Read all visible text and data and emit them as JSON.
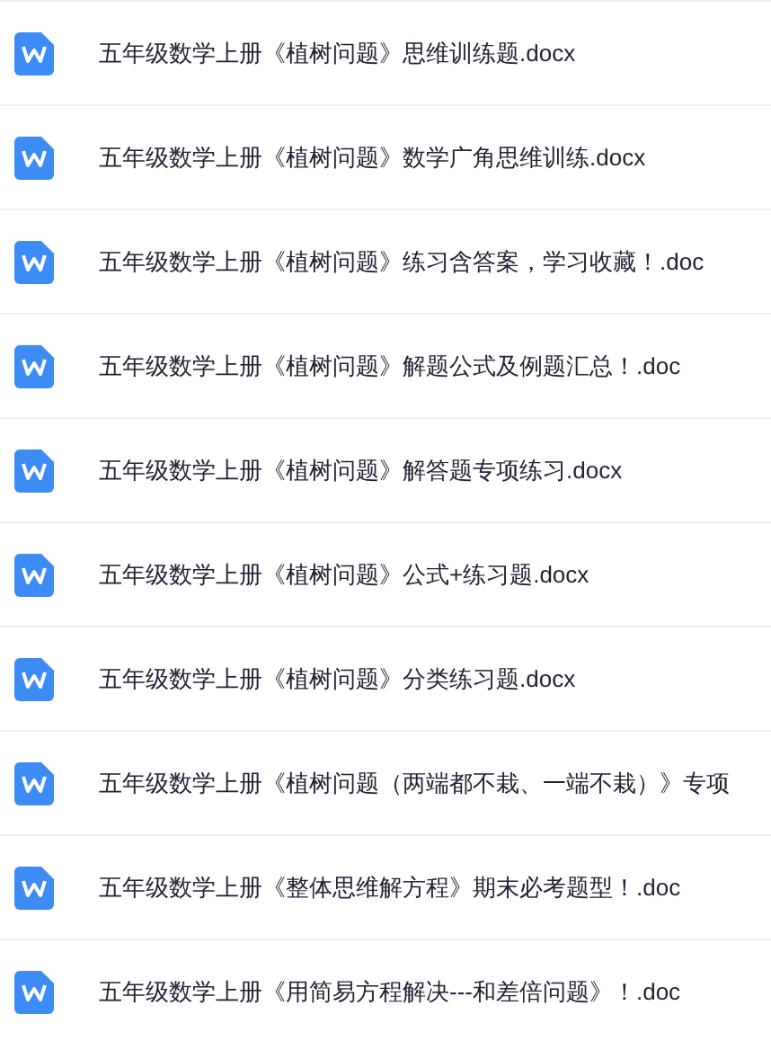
{
  "files": [
    {
      "kind": "word",
      "name": "五年级数学上册《植树问题》思维训练题.docx"
    },
    {
      "kind": "word",
      "name": "五年级数学上册《植树问题》数学广角思维训练.docx"
    },
    {
      "kind": "word",
      "name": "五年级数学上册《植树问题》练习含答案，学习收藏！.doc"
    },
    {
      "kind": "word",
      "name": "五年级数学上册《植树问题》解题公式及例题汇总！.doc"
    },
    {
      "kind": "word",
      "name": "五年级数学上册《植树问题》解答题专项练习.docx"
    },
    {
      "kind": "word",
      "name": "五年级数学上册《植树问题》公式+练习题.docx"
    },
    {
      "kind": "word",
      "name": "五年级数学上册《植树问题》分类练习题.docx"
    },
    {
      "kind": "word",
      "name": "五年级数学上册《植树问题（两端都不栽、一端不栽）》专项"
    },
    {
      "kind": "word",
      "name": "五年级数学上册《整体思维解方程》期末必考题型！.doc"
    },
    {
      "kind": "word",
      "name": "五年级数学上册《用简易方程解决---和差倍问题》！.doc"
    }
  ]
}
